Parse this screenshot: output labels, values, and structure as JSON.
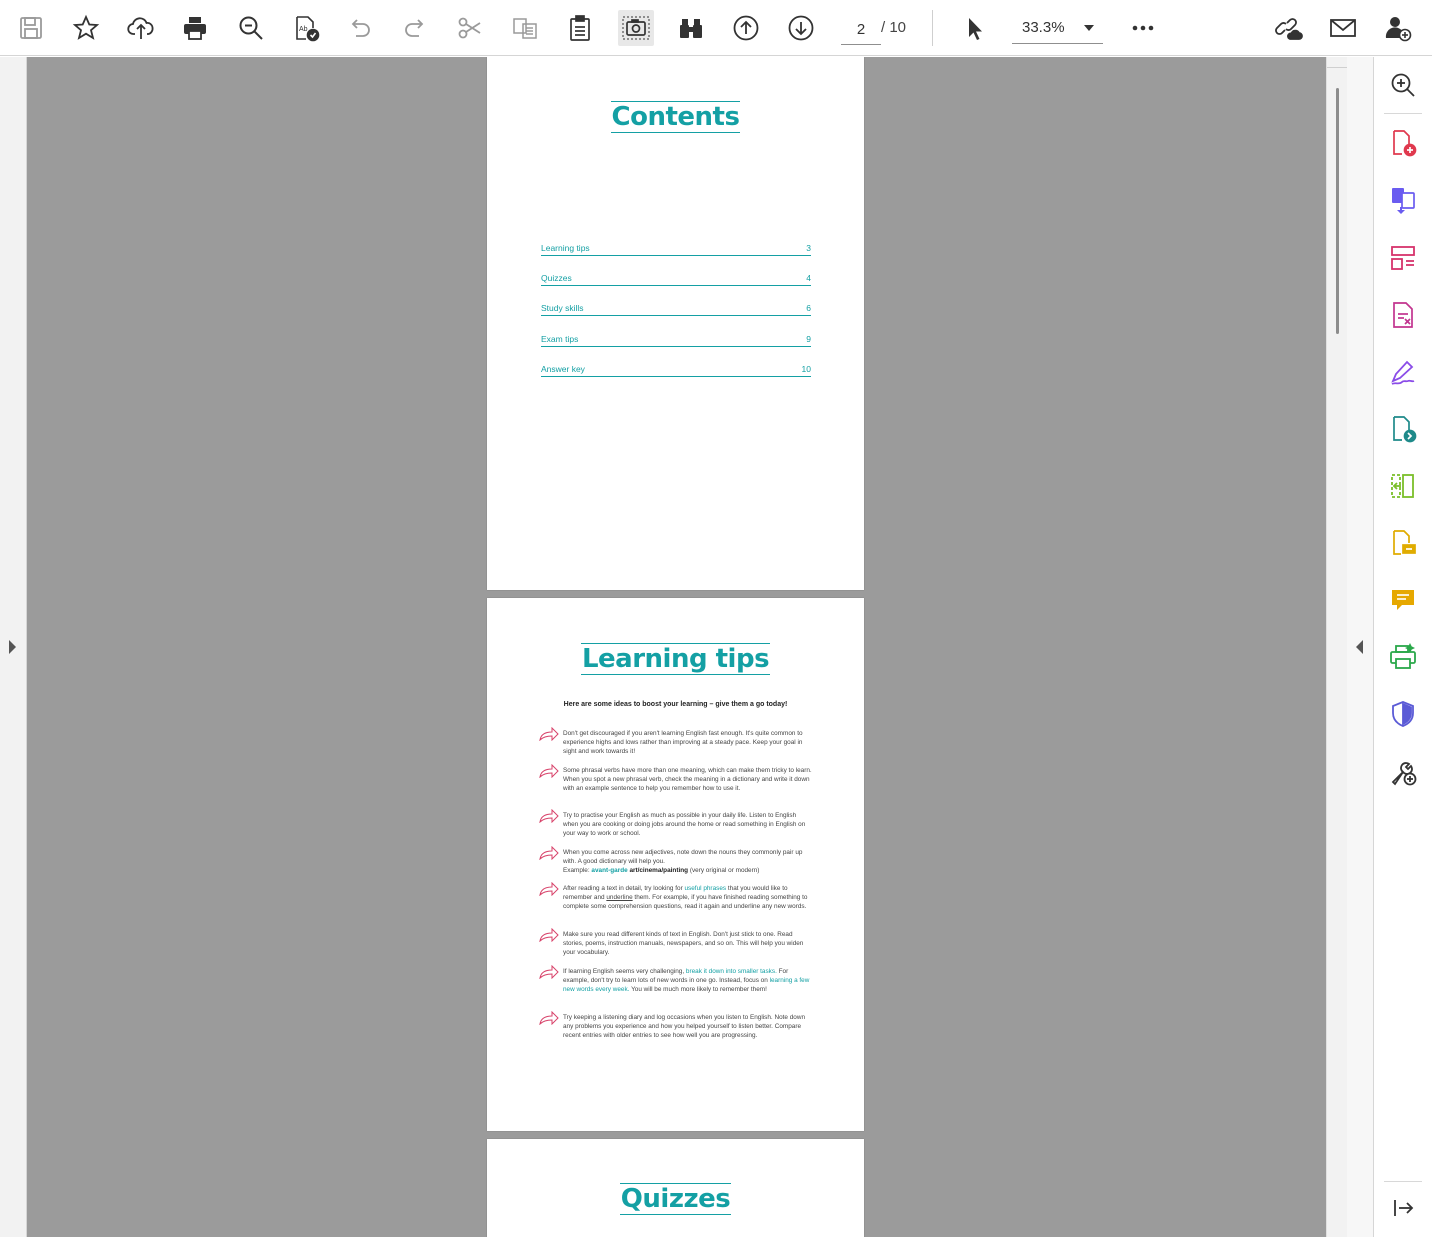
{
  "toolbar": {
    "current_page": "2",
    "total_pages": "/ 10",
    "zoom": "33.3%",
    "icons": [
      "save-icon",
      "bookmark-star-icon",
      "upload-cloud-icon",
      "print-icon",
      "find-icon",
      "spell-check-icon",
      "undo-icon",
      "redo-icon",
      "cut-icon",
      "copy-icon",
      "paste-icon",
      "snapshot-icon",
      "binoculars-icon",
      "page-up-icon",
      "page-down-icon",
      "select-cursor-icon",
      "more-icon",
      "share-link-icon",
      "email-icon",
      "add-user-icon"
    ]
  },
  "pages": {
    "contents": {
      "title": "Contents",
      "items": [
        {
          "label": "Learning tips",
          "page": "3"
        },
        {
          "label": "Quizzes",
          "page": "4"
        },
        {
          "label": "Study skills",
          "page": "6"
        },
        {
          "label": "Exam tips",
          "page": "9"
        },
        {
          "label": "Answer key",
          "page": "10"
        }
      ]
    },
    "learning_tips": {
      "title": "Learning tips",
      "intro": "Here are some ideas to boost your learning – give them a go today!",
      "tips": {
        "t1": "Don't get discouraged if you aren't learning English fast enough. It's quite common to experience highs and lows rather than improving at a steady pace. Keep your goal in sight and work towards it!",
        "t2": "Some phrasal verbs have more than one meaning, which can make them tricky to learn. When you spot a new phrasal verb, check the meaning in a dictionary and write it down with an example sentence to help you remember how to use it.",
        "t3": "Try to practise your English as much as possible in your daily life. Listen to English when you are cooking or doing jobs around the home or read something in English on your way to work or school.",
        "t4a": "When you come across new adjectives, note down the nouns they commonly pair up with. A good dictionary will help you.",
        "t4b": "Example:",
        "t4c": "avant-garde",
        "t4d": "art/cinema/painting",
        "t4e": "(very original or modern)",
        "t5a": "After reading a text in detail, try looking for",
        "t5b": "useful phrases",
        "t5c": "that you would like to remember and",
        "t5d": "underline",
        "t5e": "them. For example, if you have finished reading something to complete some comprehension questions, read it again and underline any new words.",
        "t6": "Make sure you read different kinds of text in English. Don't just stick to one. Read stories, poems, instruction manuals, newspapers, and so on. This will help you widen your vocabulary.",
        "t7a": "If learning English seems very challenging,",
        "t7b": "break it down into smaller tasks.",
        "t7c": "For example, don't try to learn lots of new words in one go. Instead, focus on",
        "t7d": "learning a few new words every week.",
        "t7e": "You will be much more likely to remember them!",
        "t8": "Try keeping a listening diary and log occasions when you listen to English. Note down any problems you experience and how you helped yourself to listen better. Compare recent entries with older entries to see how well you are progressing."
      }
    },
    "quizzes": {
      "title": "Quizzes"
    }
  },
  "tools_rail": {
    "icons": [
      "zoom-search-icon",
      "create-pdf-icon",
      "combine-files-icon",
      "organize-pages-icon",
      "edit-pdf-icon",
      "fill-sign-icon",
      "export-pdf-icon",
      "compress-pdf-icon",
      "comment-file-icon",
      "comment-icon",
      "print-production-icon",
      "protect-icon",
      "more-tools-icon",
      "collapse-panel-icon"
    ]
  },
  "colors": {
    "accent_teal": "#14a0a4",
    "arrow_pink": "#d8426a",
    "doc_bg": "#9b9b9b"
  }
}
